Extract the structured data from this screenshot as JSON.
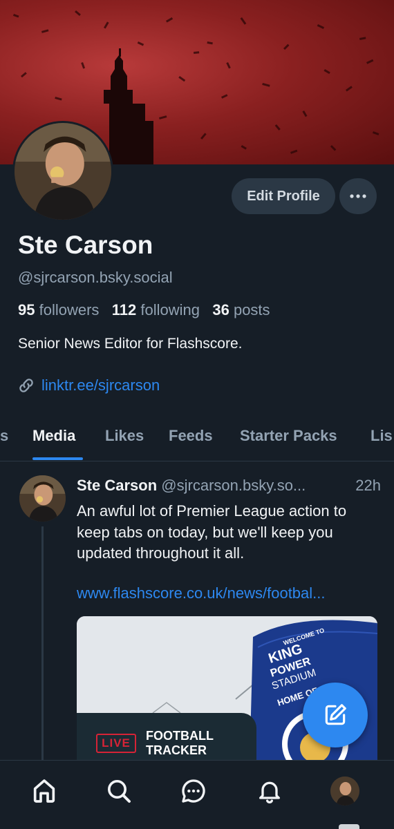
{
  "profile": {
    "name": "Ste Carson",
    "handle": "@sjrcarson.bsky.social",
    "followers_count": "95",
    "followers_label": "followers",
    "following_count": "112",
    "following_label": "following",
    "posts_count": "36",
    "posts_label": "posts",
    "bio": "Senior News Editor for Flashscore.",
    "link": "linktr.ee/sjrcarson",
    "edit_label": "Edit Profile"
  },
  "tabs": [
    {
      "label": "s"
    },
    {
      "label": "Media",
      "active": true
    },
    {
      "label": "Likes"
    },
    {
      "label": "Feeds"
    },
    {
      "label": "Starter Packs"
    },
    {
      "label": "Lis"
    }
  ],
  "post": {
    "author_name": "Ste Carson",
    "author_handle": "@sjrcarson.bsky.so...",
    "time": "22h",
    "text": "An awful lot of Premier League action to keep tabs on today, but we'll keep you updated throughout it all.",
    "link": "www.flashscore.co.uk/news/footbal...",
    "image": {
      "live_label": "LIVE",
      "tracker_title": "FOOTBALL TRACKER",
      "sign_welcome": "WELCOME TO",
      "sign_line1": "KING",
      "sign_line2": "POWER",
      "sign_line3": "STADIUM",
      "sign_line4": "HOME OF"
    }
  },
  "nav": {
    "items": [
      "home-icon",
      "search-icon",
      "chat-icon",
      "bell-icon",
      "profile-avatar"
    ]
  },
  "colors": {
    "background": "#161e27",
    "accent": "#2d88f0",
    "muted": "#93a3b3",
    "button": "#2b3845",
    "live_red": "#d62336"
  }
}
